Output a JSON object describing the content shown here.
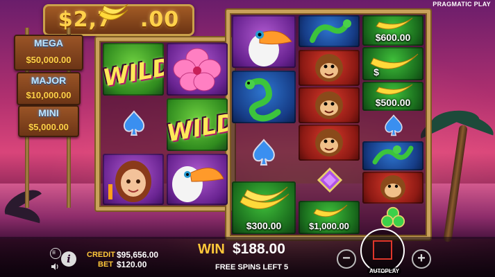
{
  "brand": "PRAGMATIC PLAY",
  "jackpots": {
    "grand": "$2,7",
    "grand_tail": ".00",
    "mega_label": "MEGA",
    "mega_value": "$50,000.00",
    "major_label": "MAJOR",
    "major_value": "$10,000.00",
    "mini_label": "MINI",
    "mini_value": "$5,000.00"
  },
  "reels": {
    "wild_label": "WILD",
    "cash_300": "$300.00",
    "cash_1000": "$1,000.00",
    "cash_600": "$600.00",
    "cash_500": "$500.00",
    "cash_partial": "$"
  },
  "status": {
    "credit_label": "CREDIT",
    "credit_value": "$95,656.00",
    "bet_label": "BET",
    "bet_value": "$120.00",
    "win_label": "WIN",
    "win_value": "$188.00",
    "free_spins": "FREE SPINS LEFT 5"
  },
  "controls": {
    "autoplay": "AUTOPLAY",
    "minus": "−",
    "plus": "+",
    "info": "i"
  },
  "colors": {
    "gold": "#ffc83a",
    "frame": "#c9a15a",
    "spin_accent": "#e0362a"
  }
}
